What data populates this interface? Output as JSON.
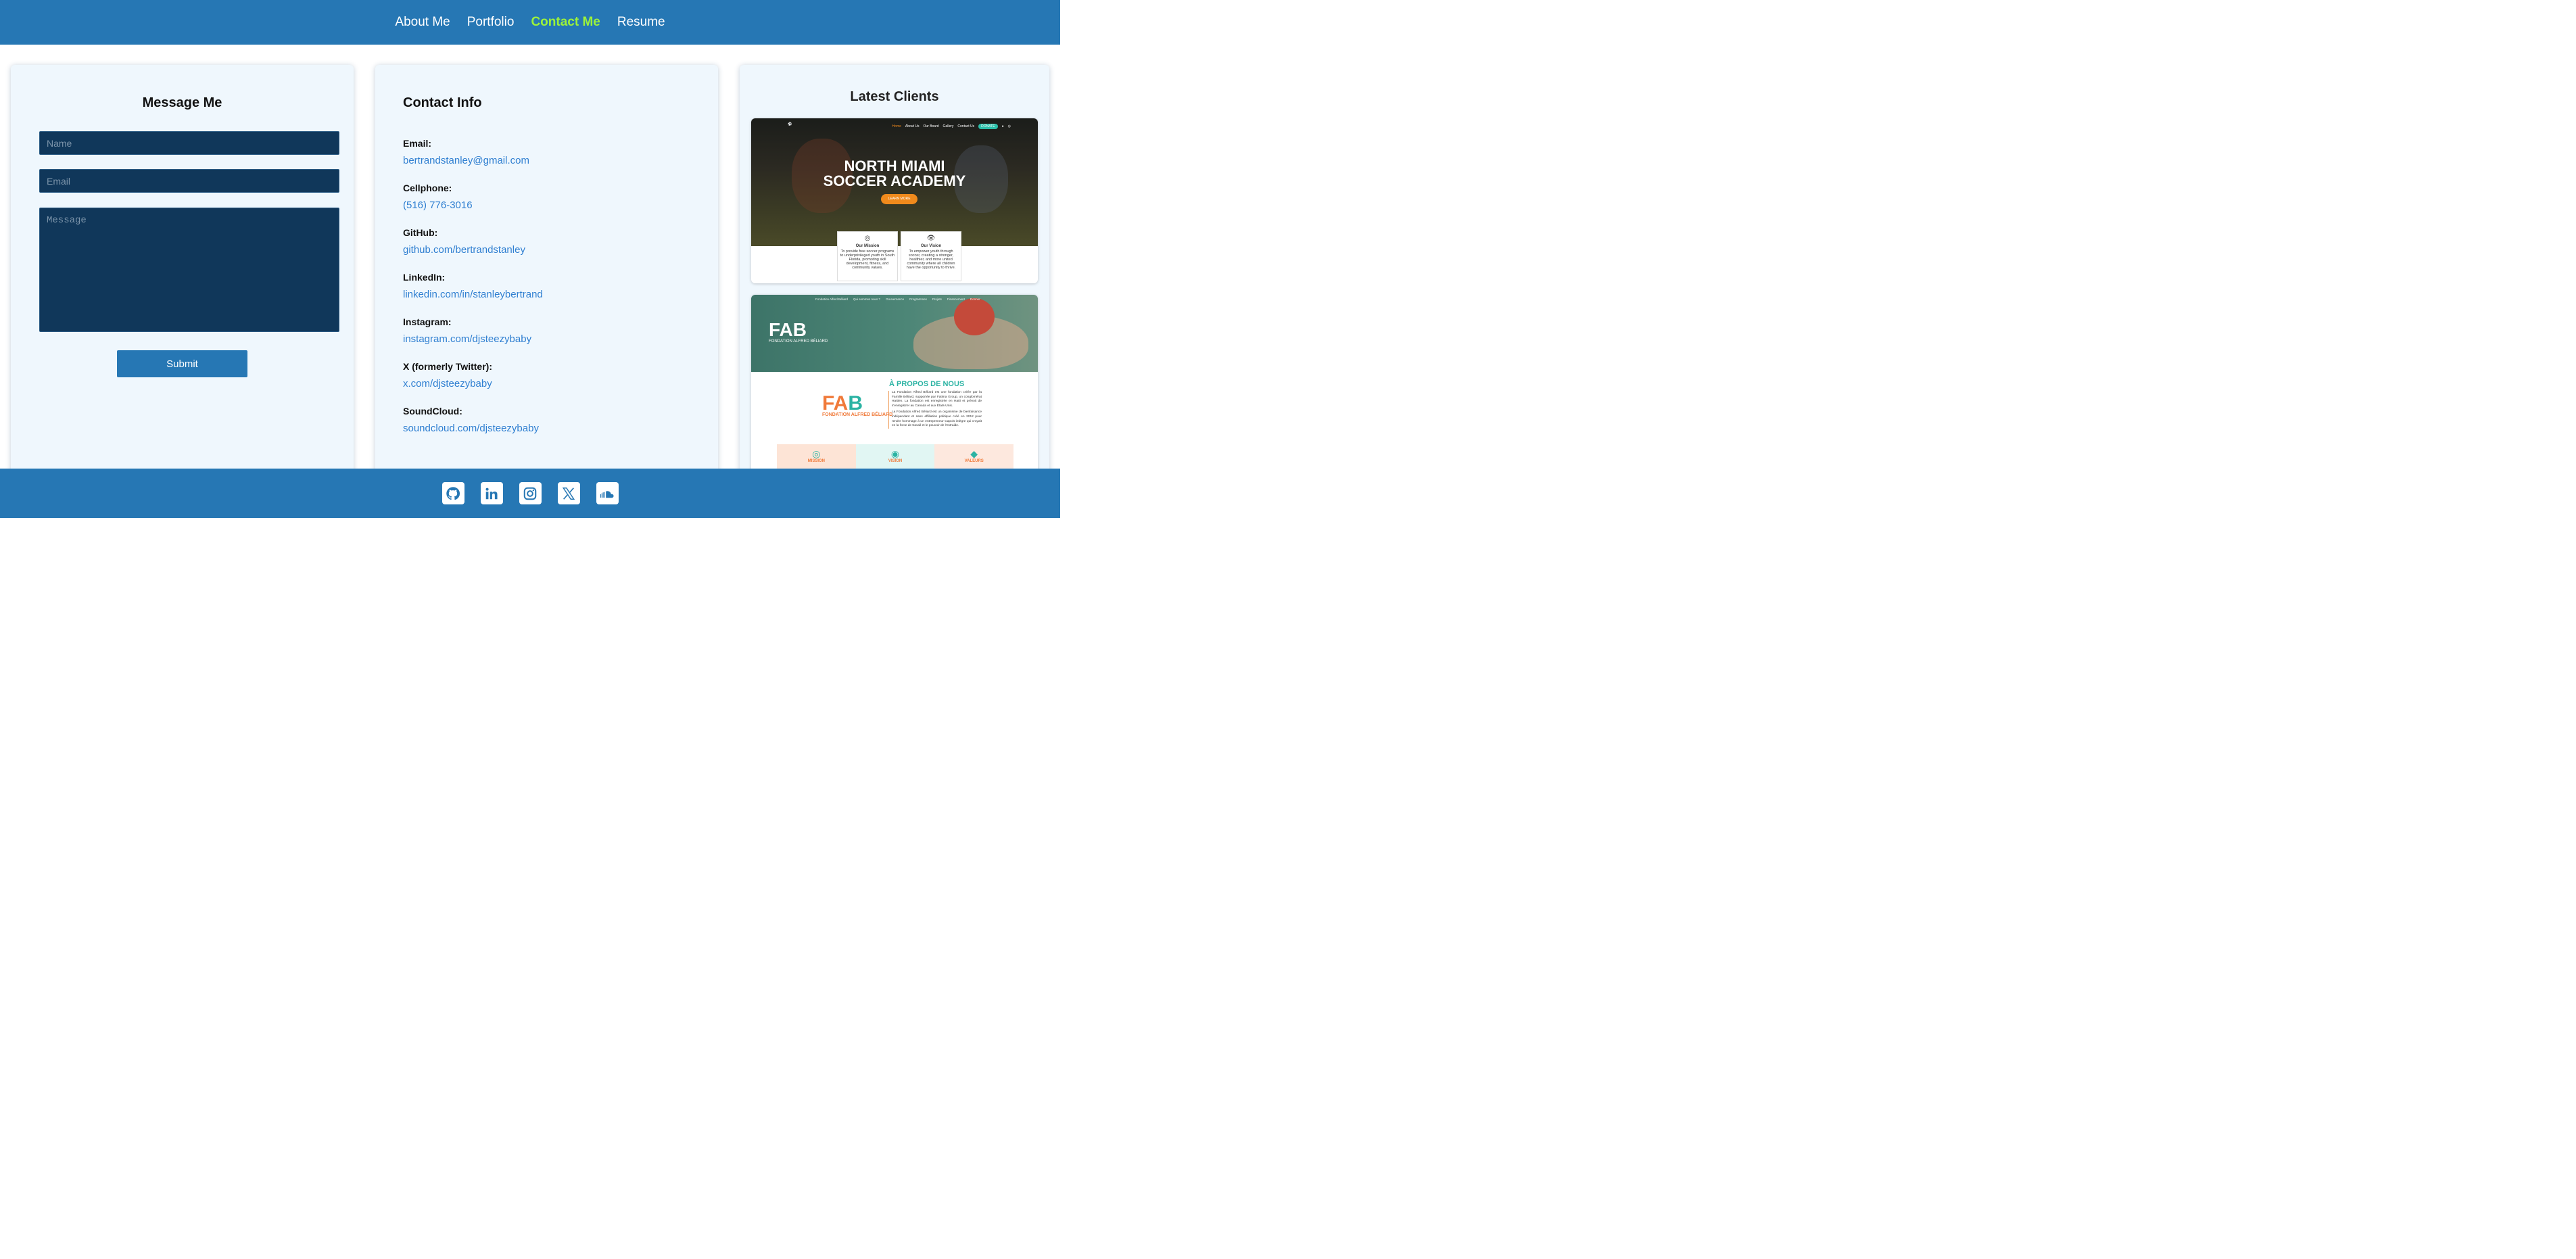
{
  "nav": {
    "items": [
      {
        "label": "About Me"
      },
      {
        "label": "Portfolio"
      },
      {
        "label": "Contact Me"
      },
      {
        "label": "Resume"
      }
    ],
    "active_color": "#9cf23a",
    "bg_color": "#2677b4"
  },
  "form": {
    "title": "Message Me",
    "name_placeholder": "Name",
    "email_placeholder": "Email",
    "message_placeholder": "Message",
    "submit_label": "Submit"
  },
  "contact": {
    "title": "Contact Info",
    "items": [
      {
        "label": "Email:",
        "value": "bertrandstanley@gmail.com"
      },
      {
        "label": "Cellphone:",
        "value": "(516) 776-3016"
      },
      {
        "label": "GitHub:",
        "value": "github.com/bertrandstanley"
      },
      {
        "label": "LinkedIn:",
        "value": "linkedin.com/in/stanleybertrand"
      },
      {
        "label": "Instagram:",
        "value": "instagram.com/djsteezybaby"
      },
      {
        "label": "X (formerly Twitter):",
        "value": "x.com/djsteezybaby"
      },
      {
        "label": "SoundCloud:",
        "value": "soundcloud.com/djsteezybaby"
      }
    ]
  },
  "clients": {
    "title": "Latest Clients",
    "client1": {
      "title_line1": "NORTH MIAMI",
      "title_line2": "SOCCER ACADEMY",
      "button": "LEARN MORE",
      "nav": [
        "Home",
        "About Us",
        "Our Board",
        "Gallery",
        "Contact Us"
      ],
      "donate": "DONATE",
      "mission_title": "Our Mission",
      "mission_text": "To provide free soccer programs to underprivileged youth in South Florida, promoting skill development, fitness, and community values.",
      "vision_title": "Our Vision",
      "vision_text": "To empower youth through soccer, creating a stronger, healthier, and more united community where all children have the opportunity to thrive."
    },
    "client2": {
      "nav": [
        "Fondation Alfred Béliard",
        "Qui sommes nous ?",
        "Gouvernance",
        "Programmes",
        "Projets",
        "Financement",
        "Donner"
      ],
      "logo": "FAB",
      "logo_sub": "FONDATION ALFRED BÉLIARD",
      "heading": "À PROPOS DE NOUS",
      "text1": "La Fondation Alfred Béliard est une fondation créée par la Famille Béliard, supportée par Fatima Group, un conglomérat Haïtien. La fondation est enregistrée en Haïti et prévoit de s'enregistrer au Canada et aux États-Unis.",
      "text2": "La Fondation Alfred Béliard est un organisme de bienfaisance indépendant et sans affiliation politique créé en 2012 pour rendre hommage à un entrepreneur Capois intègre qui croyait en la force de travail et le pouvoir de l'entraide.",
      "col1": "MISSION",
      "col2": "VISION",
      "col3": "VALEURS"
    }
  },
  "footer": {
    "icons": [
      "github-icon",
      "linkedin-icon",
      "instagram-icon",
      "x-icon",
      "soundcloud-icon"
    ],
    "bg_color": "#2677b4"
  }
}
